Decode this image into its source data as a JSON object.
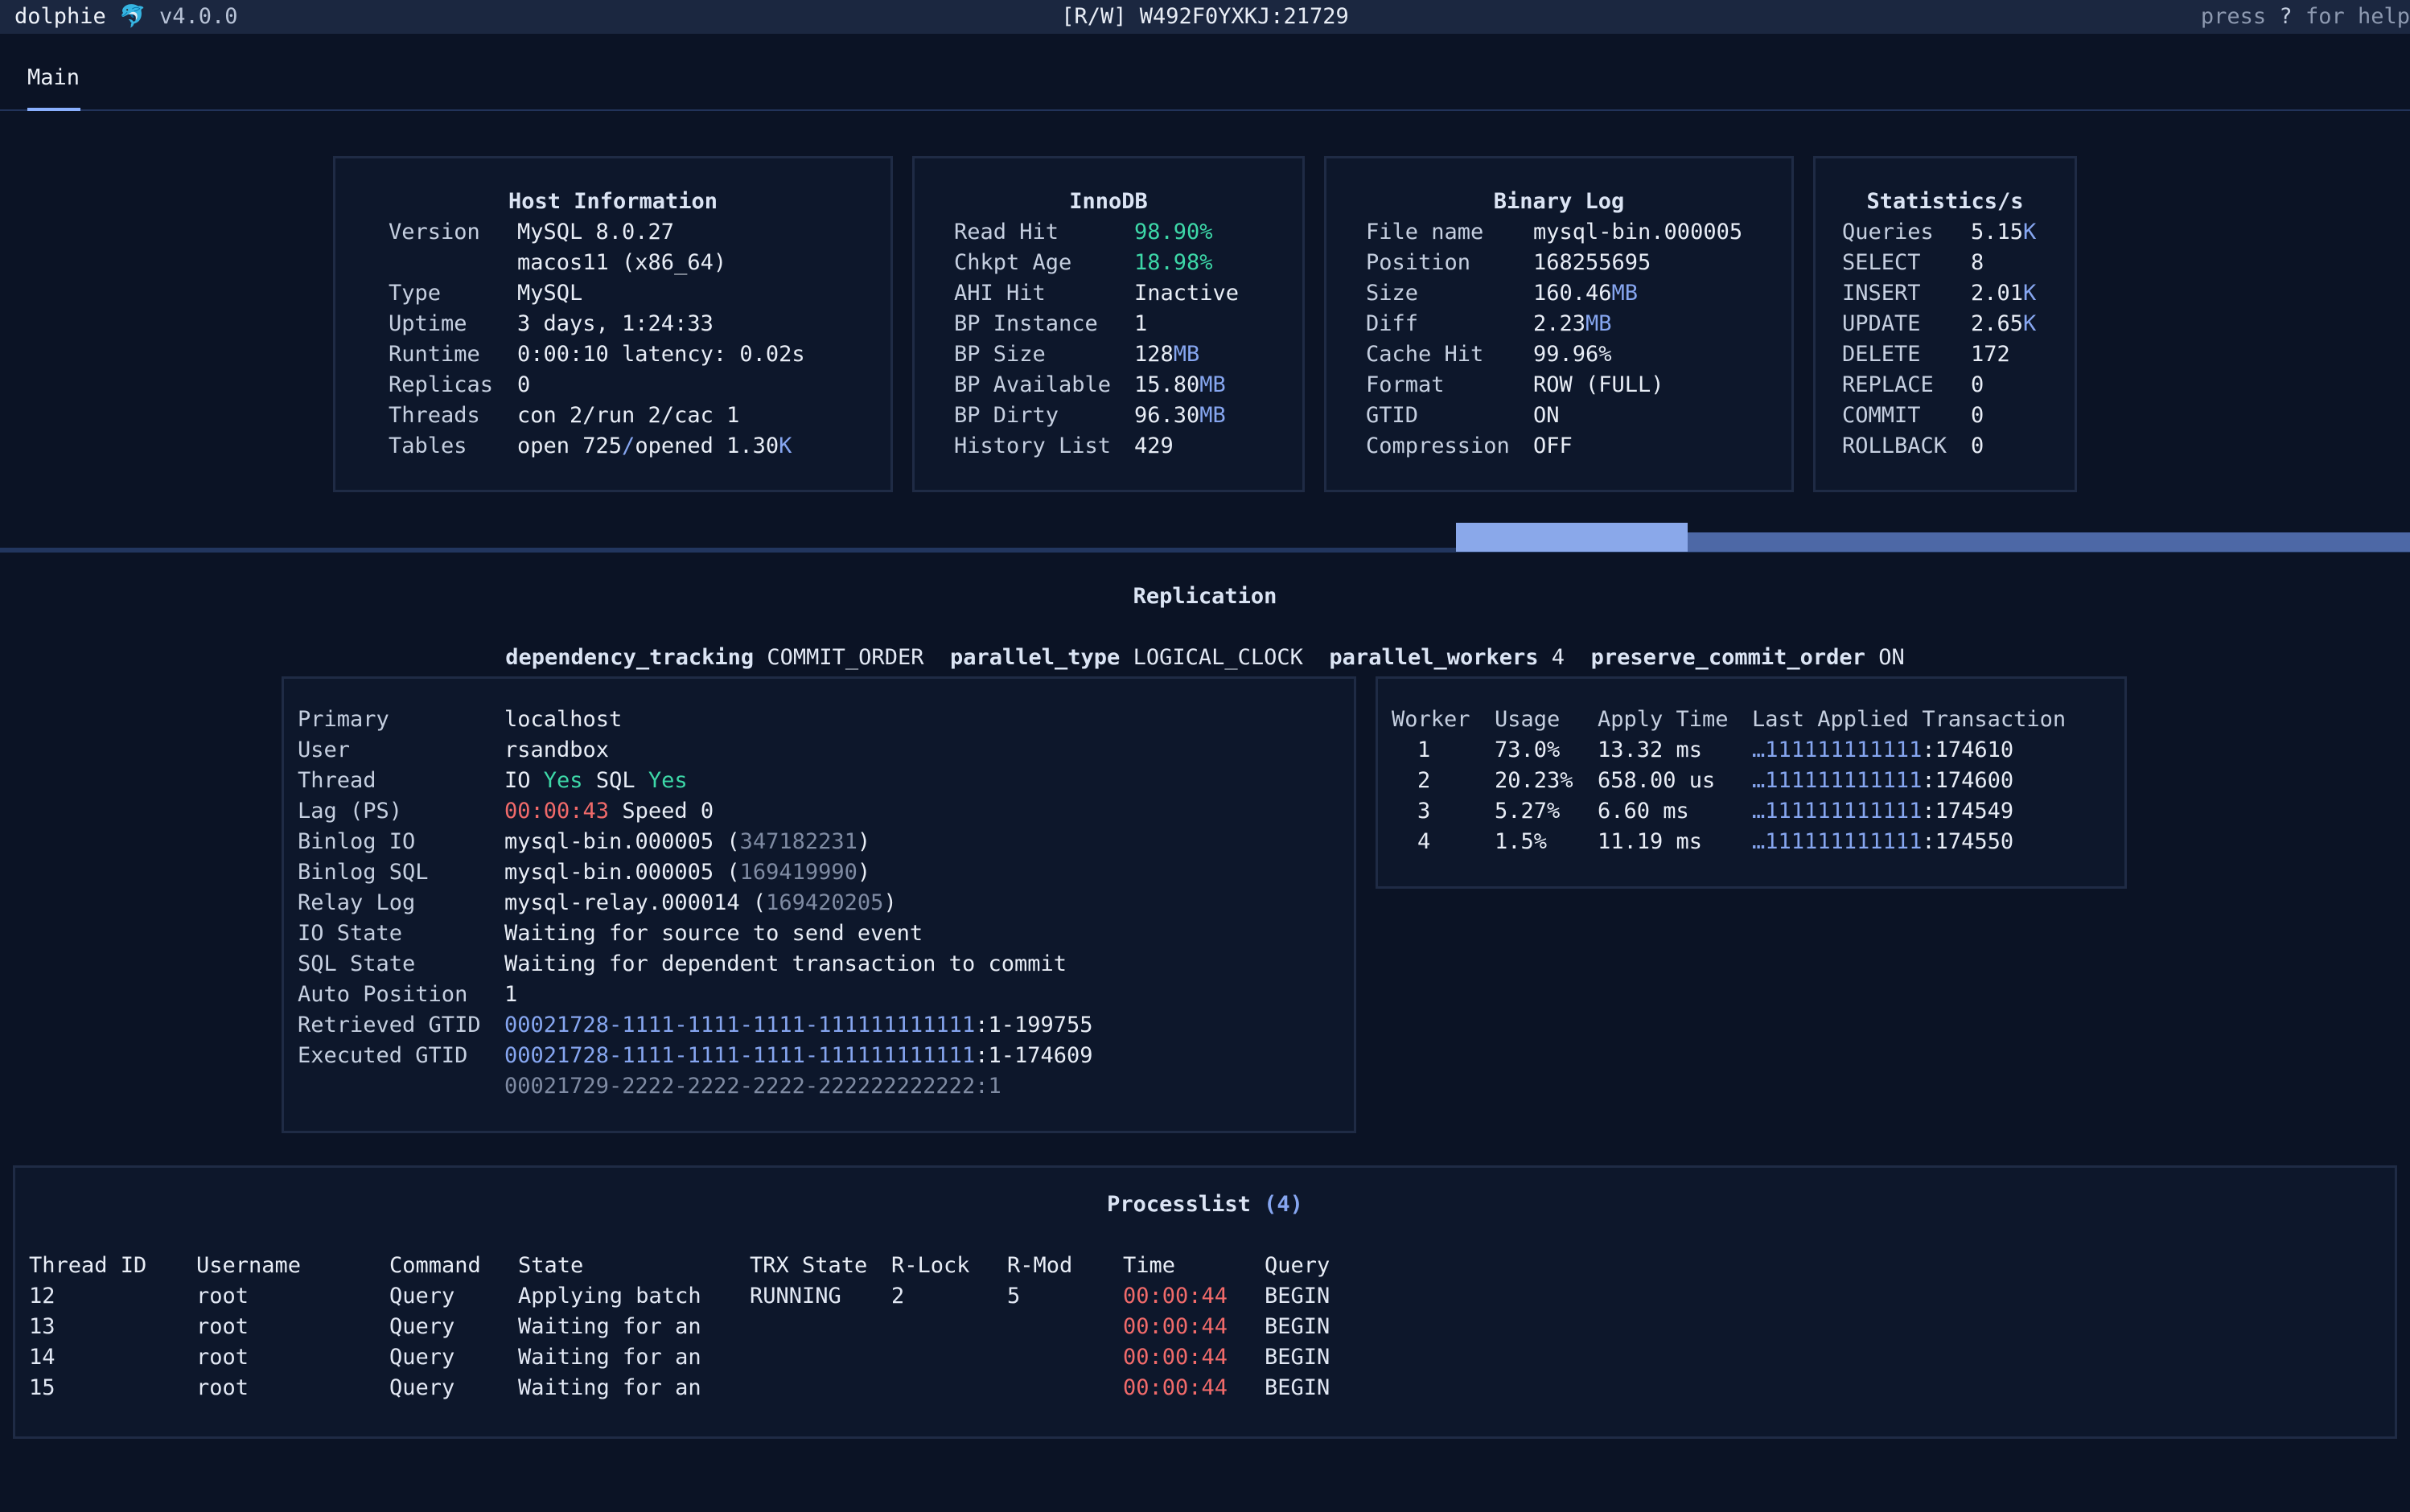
{
  "header": {
    "app_name": "dolphie",
    "app_icon": "dolphin-icon",
    "version": "v4.0.0",
    "host": "[R/W] W492F0YXKJ:21729",
    "help_pre": "press ",
    "help_key": "?",
    "help_post": " for help"
  },
  "tabs": [
    {
      "label": "Main"
    }
  ],
  "host_info": {
    "title": "Host Information",
    "rows": [
      {
        "label": "Version",
        "value": "MySQL 8.0.27"
      },
      {
        "label": "",
        "value": "macos11 (x86_64)"
      },
      {
        "label": "Type",
        "value": "MySQL"
      },
      {
        "label": "Uptime",
        "value": "3 days, 1:24:33"
      },
      {
        "label": "Runtime",
        "value": "0:00:10 latency: 0.02s"
      },
      {
        "label": "Replicas",
        "value": "0"
      },
      {
        "label": "Threads",
        "value": "con 2/run 2/cac 1"
      }
    ],
    "tables_label": "Tables",
    "tables_open": "open 725",
    "tables_sep": "/",
    "tables_opened": "opened 1.30",
    "tables_unit": "K"
  },
  "innodb": {
    "title": "InnoDB",
    "rows": [
      {
        "label": "Read Hit",
        "value": "98.90%",
        "unit": ""
      },
      {
        "label": "Chkpt Age",
        "value": "18.98%",
        "unit": ""
      },
      {
        "label": "AHI Hit",
        "value": "Inactive",
        "unit": ""
      },
      {
        "label": "BP Instance",
        "value": "1",
        "unit": ""
      },
      {
        "label": "BP Size",
        "value": "128",
        "unit": "MB"
      },
      {
        "label": "BP Available",
        "value": "15.80",
        "unit": "MB"
      },
      {
        "label": "BP Dirty",
        "value": "96.30",
        "unit": "MB"
      },
      {
        "label": "History List",
        "value": "429",
        "unit": ""
      }
    ]
  },
  "binlog": {
    "title": "Binary Log",
    "rows": [
      {
        "label": "File name",
        "value": "mysql-bin.000005",
        "unit": ""
      },
      {
        "label": "Position",
        "value": "168255695",
        "unit": ""
      },
      {
        "label": "Size",
        "value": "160.46",
        "unit": "MB"
      },
      {
        "label": "Diff",
        "value": "2.23",
        "unit": "MB"
      },
      {
        "label": "Cache Hit",
        "value": "99.96%",
        "unit": ""
      },
      {
        "label": "Format",
        "value": "ROW (FULL)",
        "unit": ""
      },
      {
        "label": "GTID",
        "value": "ON",
        "unit": ""
      },
      {
        "label": "Compression",
        "value": "OFF",
        "unit": ""
      }
    ]
  },
  "stats": {
    "title": "Statistics/s",
    "rows": [
      {
        "label": "Queries",
        "value": "5.15",
        "unit": "K"
      },
      {
        "label": "SELECT",
        "value": "8",
        "unit": ""
      },
      {
        "label": "INSERT",
        "value": "2.01",
        "unit": "K"
      },
      {
        "label": "UPDATE",
        "value": "2.65",
        "unit": "K"
      },
      {
        "label": "DELETE",
        "value": "172",
        "unit": ""
      },
      {
        "label": "REPLACE",
        "value": "0",
        "unit": ""
      },
      {
        "label": "COMMIT",
        "value": "0",
        "unit": ""
      },
      {
        "label": "ROLLBACK",
        "value": "0",
        "unit": ""
      }
    ]
  },
  "replication": {
    "title": "Replication",
    "params": [
      {
        "key": "dependency_tracking",
        "value": "COMMIT_ORDER"
      },
      {
        "key": "parallel_type",
        "value": "LOGICAL_CLOCK"
      },
      {
        "key": "parallel_workers",
        "value": "4"
      },
      {
        "key": "preserve_commit_order",
        "value": "ON"
      }
    ],
    "primary": {
      "label": "Primary",
      "value": "localhost"
    },
    "user": {
      "label": "User",
      "value": "rsandbox"
    },
    "thread": {
      "label": "Thread",
      "io": "IO",
      "io_val": "Yes",
      "sql": "SQL",
      "sql_val": "Yes"
    },
    "lag": {
      "label": "Lag (PS)",
      "value": "00:00:43",
      "speed_label": "Speed",
      "speed": "0"
    },
    "binlog_io": {
      "label": "Binlog IO",
      "file": "mysql-bin.000005",
      "pos": "347182231"
    },
    "binlog_sql": {
      "label": "Binlog SQL",
      "file": "mysql-bin.000005",
      "pos": "169419990"
    },
    "relay_log": {
      "label": "Relay Log",
      "file": "mysql-relay.000014",
      "pos": "169420205"
    },
    "io_state": {
      "label": "IO State",
      "value": "Waiting for source to send event"
    },
    "sql_state": {
      "label": "SQL State",
      "value": "Waiting for dependent transaction to commit"
    },
    "auto_position": {
      "label": "Auto Position",
      "value": "1"
    },
    "retrieved_gtid": {
      "label": "Retrieved GTID",
      "uuid": "00021728-1111-1111-1111-111111111111",
      "range": ":1-199755"
    },
    "executed_gtid": {
      "label": "Executed GTID",
      "uuid": "00021728-1111-1111-1111-111111111111",
      "range": ":1-174609",
      "extra": "00021729-2222-2222-2222-222222222222:1"
    },
    "workers": {
      "headers": [
        "Worker",
        "Usage",
        "Apply Time",
        "Last Applied Transaction"
      ],
      "rows": [
        {
          "id": "1",
          "usage": "73.0%",
          "apply": "13.32 ms",
          "uuid": "…111111111111",
          "txn": ":174610"
        },
        {
          "id": "2",
          "usage": "20.23%",
          "apply": "658.00 us",
          "uuid": "…111111111111",
          "txn": ":174600"
        },
        {
          "id": "3",
          "usage": "5.27%",
          "apply": "6.60 ms",
          "uuid": "…111111111111",
          "txn": ":174549"
        },
        {
          "id": "4",
          "usage": "1.5%",
          "apply": "11.19 ms",
          "uuid": "…111111111111",
          "txn": ":174550"
        }
      ]
    }
  },
  "processlist": {
    "title": "Processlist",
    "count_open": "(",
    "count": "4",
    "count_close": ")",
    "headers": [
      "Thread ID",
      "Username",
      "Command",
      "State",
      "TRX State",
      "R-Lock",
      "R-Mod",
      "Time",
      "Query"
    ],
    "rows": [
      {
        "id": "12",
        "user": "root",
        "cmd": "Query",
        "state": "Applying batch",
        "trx": "RUNNING",
        "rlock": "2",
        "rmod": "5",
        "time": "00:00:44",
        "query": "BEGIN"
      },
      {
        "id": "13",
        "user": "root",
        "cmd": "Query",
        "state": "Waiting for an",
        "trx": "",
        "rlock": "",
        "rmod": "",
        "time": "00:00:44",
        "query": "BEGIN"
      },
      {
        "id": "14",
        "user": "root",
        "cmd": "Query",
        "state": "Waiting for an",
        "trx": "",
        "rlock": "",
        "rmod": "",
        "time": "00:00:44",
        "query": "BEGIN"
      },
      {
        "id": "15",
        "user": "root",
        "cmd": "Query",
        "state": "Waiting for an",
        "trx": "",
        "rlock": "",
        "rmod": "",
        "time": "00:00:44",
        "query": "BEGIN"
      }
    ]
  }
}
